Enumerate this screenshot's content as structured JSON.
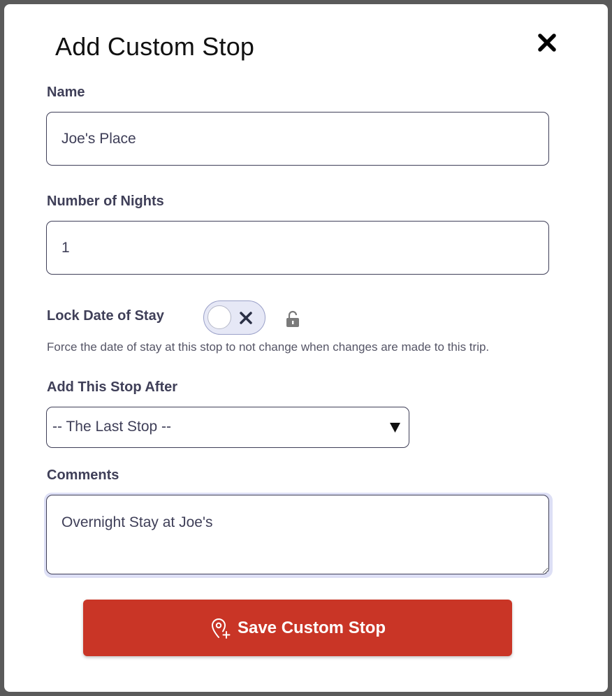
{
  "modal": {
    "title": "Add Custom Stop"
  },
  "icons": {
    "close": "close-icon",
    "toggle_off": "x-icon",
    "lock": "unlocked-lock-icon",
    "caret": "caret-down-icon",
    "save": "add-location-pin-icon"
  },
  "fields": {
    "name": {
      "label": "Name",
      "value": "Joe's Place"
    },
    "nights": {
      "label": "Number of Nights",
      "value": "1"
    },
    "lock_date": {
      "label": "Lock Date of Stay",
      "checked": false,
      "help": "Force the date of stay at this stop to not change when changes are made to this trip."
    },
    "after_stop": {
      "label": "Add This Stop After",
      "selected": "-- The Last Stop --"
    },
    "comments": {
      "label": "Comments",
      "value": "Overnight Stay at Joe's"
    }
  },
  "actions": {
    "save_label": "Save Custom Stop"
  },
  "colors": {
    "primary_button": "#c93526",
    "text": "#3f3f58",
    "focus_ring": "#dddff5"
  }
}
